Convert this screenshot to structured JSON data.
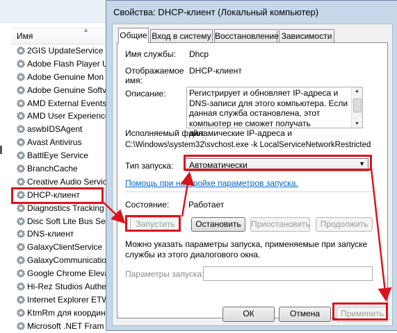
{
  "services_panel": {
    "column_header": "Имя",
    "services": [
      "2GIS UpdateService",
      "Adobe Flash Player U",
      "Adobe Genuine Mon",
      "Adobe Genuine Softv",
      "AMD External Events",
      "AMD User Experience",
      "aswbIDSAgent",
      "Avast Antivirus",
      "BattlEye Service",
      "BranchCache",
      "Creative Audio Servic",
      "DHCP-клиент",
      "Diagnostics Tracking",
      "Disc Soft Lite Bus Ser",
      "DNS-клиент",
      "GalaxyClientService",
      "GalaxyCommunicatio",
      "Google Chrome Eleva",
      "Hi-Rez Studios Authe",
      "Internet Explorer ETW",
      "KtmRm для координ",
      "Microsoft .NET Fram"
    ]
  },
  "dialog": {
    "title": "Свойства: DHCP-клиент (Локальный компьютер)",
    "tabs": [
      "Общие",
      "Вход в систему",
      "Восстановление",
      "Зависимости"
    ],
    "service_name_label": "Имя службы:",
    "service_name_value": "Dhcp",
    "display_name_label_line1": "Отображаемое",
    "display_name_label_line2": "имя:",
    "display_name_value": "DHCP-клиент",
    "description_label": "Описание:",
    "description_text": "Регистрирует и обновляет IP-адреса и DNS-записи для этого компьютера. Если данная служба остановлена, этот компьютер не сможет получать динамические IP-адреса и",
    "executable_label": "Исполняемый файл:",
    "executable_path": "C:\\Windows\\system32\\svchost.exe -k LocalServiceNetworkRestricted",
    "startup_type_label": "Тип запуска:",
    "startup_type_value": "Автоматически",
    "help_link": "Помощь при настройке параметров запуска.",
    "status_label": "Состояние:",
    "status_value": "Работает",
    "buttons": {
      "start": "Запустить",
      "stop": "Остановить",
      "pause": "Приостановить",
      "resume": "Продолжить"
    },
    "params_hint": "Можно указать параметры запуска, применяемые при запуске службы из этого диалогового окна.",
    "params_label": "Параметры запуска:",
    "params_value": "",
    "footer": {
      "ok": "ОК",
      "cancel": "Отмена",
      "apply": "Применить"
    }
  },
  "colors": {
    "annotation": "#d9141e",
    "link": "#0066cc",
    "dialog_frame": "#c7d7ea"
  }
}
